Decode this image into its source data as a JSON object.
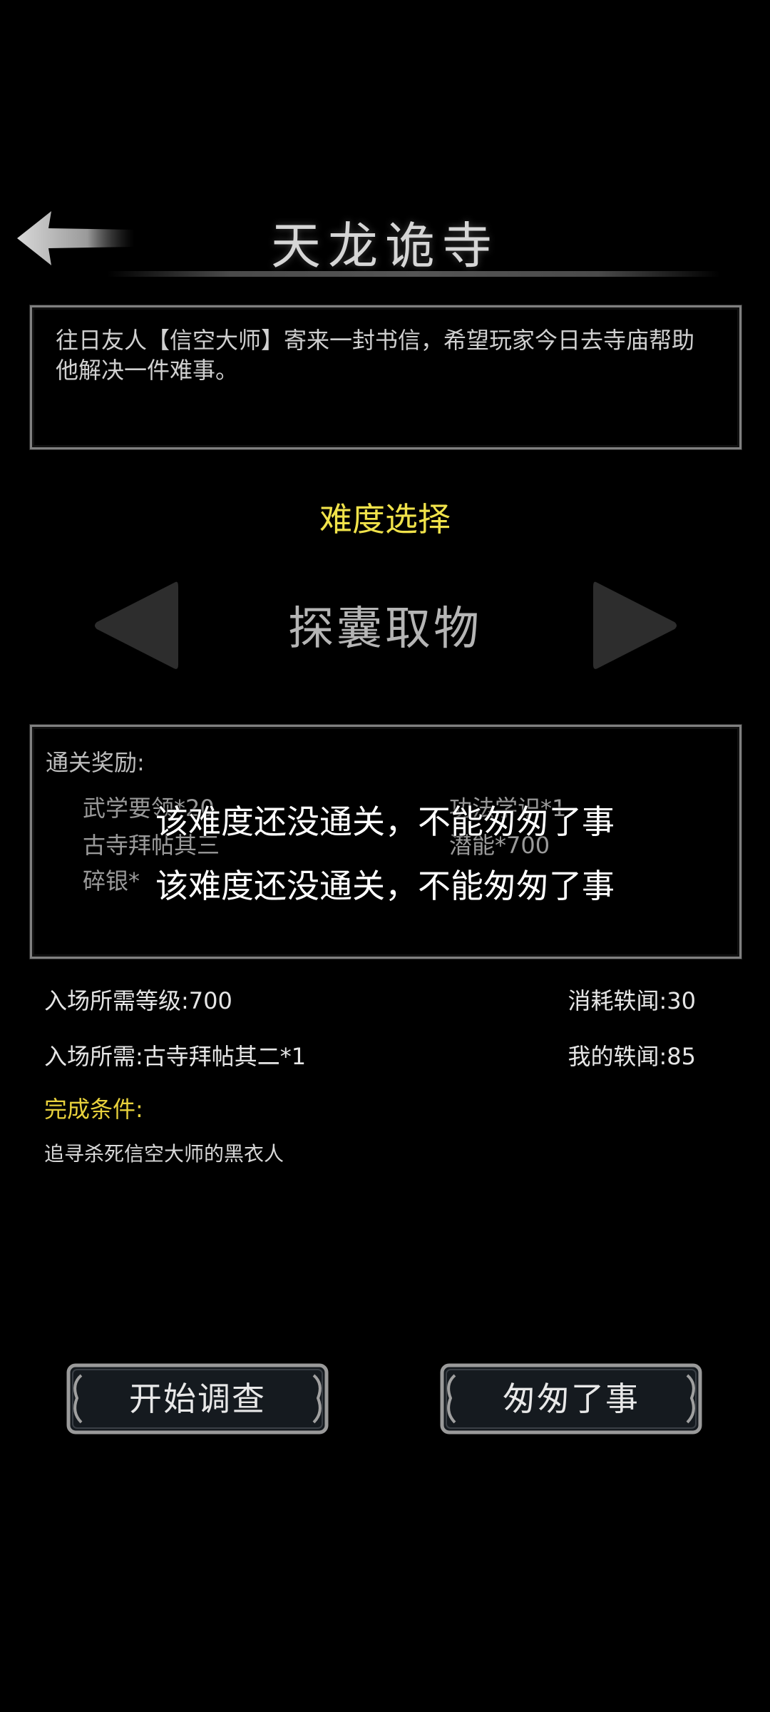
{
  "header": {
    "title": "天龙诡寺",
    "back_icon": "back-arrow-icon"
  },
  "intro": {
    "text": "往日友人【信空大师】寄来一封书信，希望玩家今日去寺庙帮助他解决一件难事。"
  },
  "difficulty": {
    "label": "难度选择",
    "value": "探囊取物",
    "prev_icon": "triangle-left-icon",
    "next_icon": "triangle-right-icon"
  },
  "rewards": {
    "title": "通关奖励:",
    "items": [
      "武学要领*20",
      "功法学识*1",
      "古寺拜帖其三",
      "潜能*700",
      "碎银*"
    ]
  },
  "toast": {
    "messages": [
      "该难度还没通关，不能匆匆了事",
      "该难度还没通关，不能匆匆了事"
    ]
  },
  "requirements": {
    "level": "入场所需等级:700",
    "cost": "消耗轶闻:30",
    "item": "入场所需:古寺拜帖其二*1",
    "mine": "我的轶闻:85"
  },
  "condition": {
    "label": "完成条件:",
    "text": "追寻杀死信空大师的黑衣人"
  },
  "buttons": {
    "start": "开始调查",
    "leave": "匆匆了事"
  },
  "colors": {
    "background": "#000000",
    "accent_yellow": "#f0e24a",
    "button_fill": "#151a1f",
    "frame_border": "#808080"
  }
}
